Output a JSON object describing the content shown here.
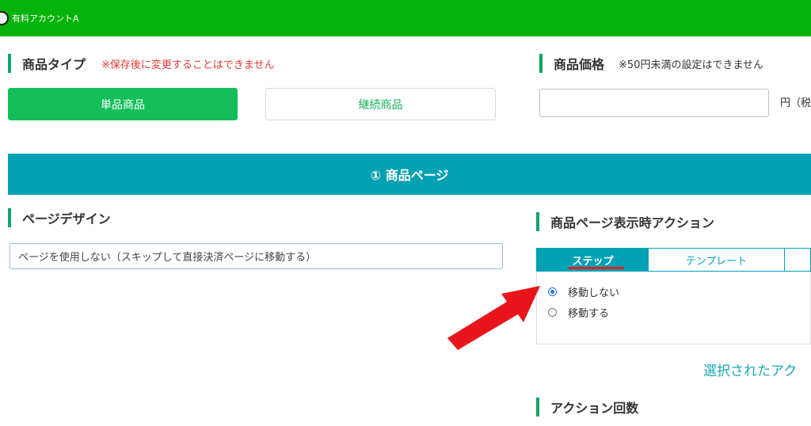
{
  "header": {
    "account_name": "有料アカウントA",
    "color": "#05b30a"
  },
  "product_type": {
    "title": "商品タイプ",
    "note": "※保存後に変更することはできません",
    "note_color": "#e53935",
    "options": [
      "単品商品",
      "継続商品"
    ],
    "selected": "単品商品"
  },
  "product_price": {
    "title": "商品価格",
    "note": "※50円未満の設定はできません",
    "value": "",
    "unit": "円（税"
  },
  "banner": {
    "label": "① 商品ページ",
    "color": "#04a1b3"
  },
  "page_design": {
    "title": "ページデザイン",
    "selected": "ページを使用しない（スキップして直接決済ページに移動する）"
  },
  "page_action": {
    "title": "商品ページ表示時アクション",
    "tabs": [
      "ステップ",
      "テンプレート",
      ""
    ],
    "active_tab": "ステップ",
    "radios": [
      {
        "label": "移動しない",
        "checked": true
      },
      {
        "label": "移動する",
        "checked": false
      }
    ],
    "link": "選択されたアク"
  },
  "action_count": {
    "title": "アクション回数"
  },
  "annotation": {
    "arrow_color": "#e8161c",
    "underline_color": "#e02020"
  }
}
